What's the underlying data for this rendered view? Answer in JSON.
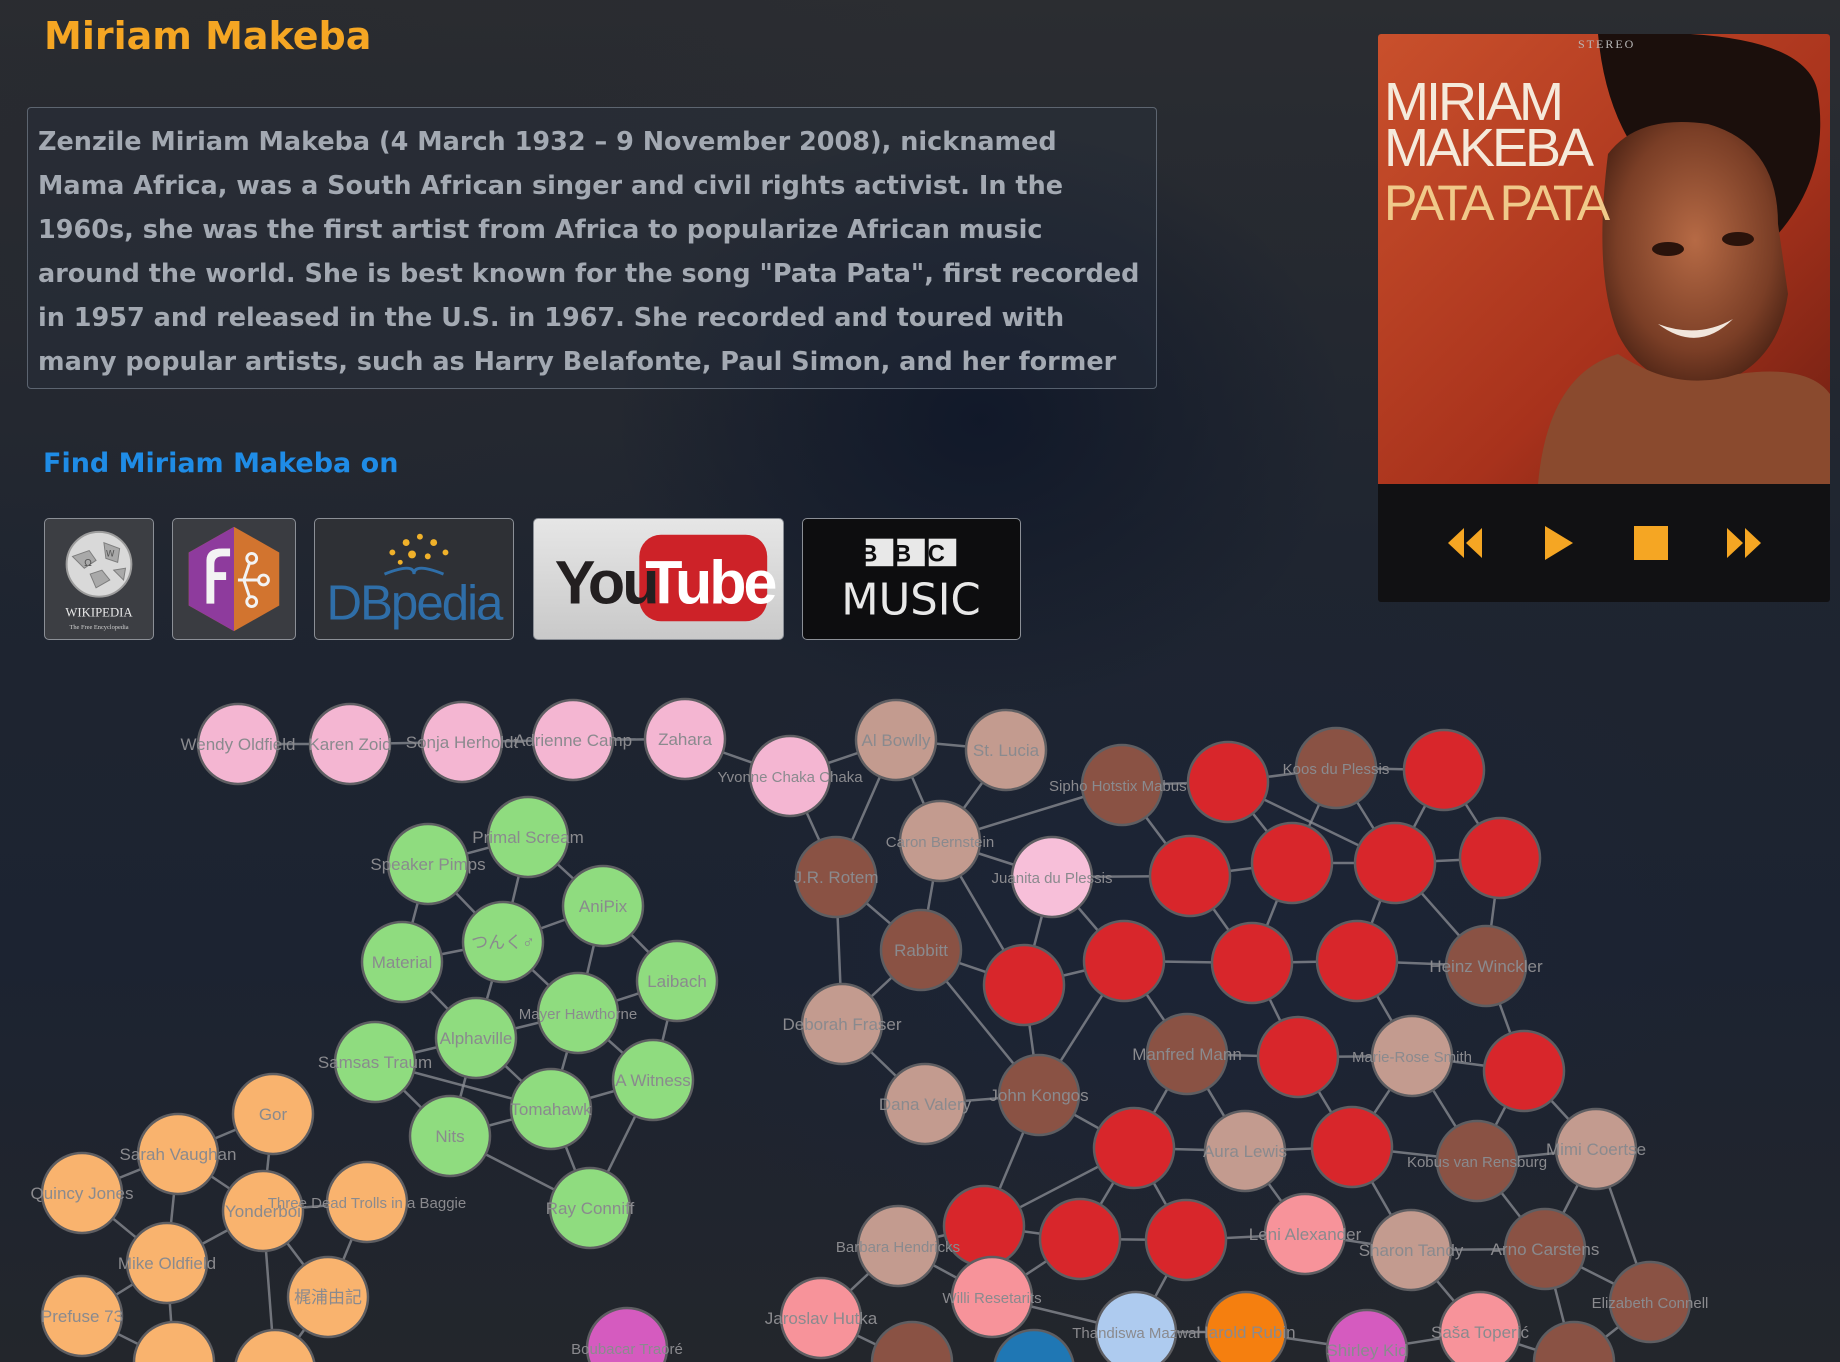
{
  "artist": {
    "name": "Miriam Makeba",
    "bio": "Zenzile Miriam Makeba (4 March 1932 – 9 November 2008), nicknamed Mama Africa, was a South African singer and civil rights activist. In the 1960s, she was the first artist from Africa to popularize African music around the world. She is best known for the song \"Pata Pata\", first recorded in 1957 and released in the U.S. in 1967. She recorded and toured with many popular artists, such as Harry Belafonte, Paul Simon, and her former husband Hugh Masekela. Makeba"
  },
  "find_on": {
    "heading": "Find Miriam Makeba on",
    "links": [
      {
        "name": "Wikipedia",
        "title": "WIKIPEDIA",
        "subtitle": "The Free Encyclopedia"
      },
      {
        "name": "Music Ontology"
      },
      {
        "name": "DBpedia",
        "title": "DBpedia"
      },
      {
        "name": "YouTube",
        "title_a": "You",
        "title_b": "Tube"
      },
      {
        "name": "BBC Music",
        "title_a": "BBC",
        "title_b": "MUSIC"
      }
    ]
  },
  "player": {
    "album_title_line1": "MIRIAM",
    "album_title_line2": "MAKEBA",
    "album_subtitle": "PATA PATA",
    "album_corner": "STEREO",
    "controls": [
      "rewind",
      "play",
      "stop",
      "fast-forward"
    ]
  },
  "colors": {
    "title": "#f5a623",
    "find_heading": "#1f8ce6",
    "control": "#f5a623",
    "pink": "#f4b6d2",
    "green": "#8fdc7f",
    "orange": "#f9b36e",
    "brown": "#8a5244",
    "tan": "#c39b8f",
    "red": "#d8262b",
    "salmon": "#f7939a",
    "light_blue": "#aecbef",
    "dark_orange": "#f57f0f",
    "magenta": "#d55bbf",
    "blue": "#1f77b4",
    "light_pink": "#f7bfd9"
  },
  "graph": {
    "nodes": [
      {
        "id": "wendy",
        "label": "Wendy Oldfield",
        "c": "pink"
      },
      {
        "id": "karen",
        "label": "Karen Zoid",
        "c": "pink"
      },
      {
        "id": "sonja",
        "label": "Sonja Herholdt",
        "c": "pink"
      },
      {
        "id": "adrienne",
        "label": "Adrienne Camp",
        "c": "pink"
      },
      {
        "id": "zahara",
        "label": "Zahara",
        "c": "pink"
      },
      {
        "id": "yvonne",
        "label": "Yvonne Chaka Chaka",
        "c": "pink"
      },
      {
        "id": "albowlly",
        "label": "Al Bowlly",
        "c": "tan"
      },
      {
        "id": "stlucia",
        "label": "St. Lucia",
        "c": "tan"
      },
      {
        "id": "sipho",
        "label": "Sipho Hotstix Mabuse",
        "c": "brown"
      },
      {
        "id": "r1",
        "label": "",
        "c": "red"
      },
      {
        "id": "koos",
        "label": "Koos du Plessis",
        "c": "brown"
      },
      {
        "id": "r2",
        "label": "",
        "c": "red"
      },
      {
        "id": "caron",
        "label": "Caron Bernstein",
        "c": "tan"
      },
      {
        "id": "jrrotem",
        "label": "J.R. Rotem",
        "c": "brown"
      },
      {
        "id": "juanita",
        "label": "Juanita du Plessis",
        "c": "light_pink"
      },
      {
        "id": "r3",
        "label": "",
        "c": "red"
      },
      {
        "id": "r4",
        "label": "",
        "c": "red"
      },
      {
        "id": "r5",
        "label": "",
        "c": "red"
      },
      {
        "id": "r6",
        "label": "",
        "c": "red"
      },
      {
        "id": "rabbitt",
        "label": "Rabbitt",
        "c": "brown"
      },
      {
        "id": "r7",
        "label": "",
        "c": "red"
      },
      {
        "id": "r8",
        "label": "",
        "c": "red"
      },
      {
        "id": "r9",
        "label": "",
        "c": "red"
      },
      {
        "id": "r10",
        "label": "",
        "c": "red"
      },
      {
        "id": "hwinckler",
        "label": "Heinz Winckler",
        "c": "brown"
      },
      {
        "id": "deborah",
        "label": "Deborah Fraser",
        "c": "tan"
      },
      {
        "id": "manfred",
        "label": "Manfred Mann",
        "c": "brown"
      },
      {
        "id": "r11",
        "label": "",
        "c": "red"
      },
      {
        "id": "marierose",
        "label": "Marie-Rose Smith",
        "c": "tan"
      },
      {
        "id": "r12",
        "label": "",
        "c": "red"
      },
      {
        "id": "dana",
        "label": "Dana Valery",
        "c": "tan"
      },
      {
        "id": "johnkongos",
        "label": "John Kongos",
        "c": "brown"
      },
      {
        "id": "r13",
        "label": "",
        "c": "red"
      },
      {
        "id": "auralewis",
        "label": "Aura Lewis",
        "c": "tan"
      },
      {
        "id": "r14",
        "label": "",
        "c": "red"
      },
      {
        "id": "kobus",
        "label": "Kobus van Rensburg",
        "c": "brown"
      },
      {
        "id": "mimi",
        "label": "Mimi Coertse",
        "c": "tan"
      },
      {
        "id": "r15",
        "label": "",
        "c": "red"
      },
      {
        "id": "r16",
        "label": "",
        "c": "red"
      },
      {
        "id": "r17",
        "label": "",
        "c": "red"
      },
      {
        "id": "leni",
        "label": "Leni Alexander",
        "c": "salmon"
      },
      {
        "id": "sharon",
        "label": "Sharon Tandy",
        "c": "tan"
      },
      {
        "id": "arno",
        "label": "Arno Carstens",
        "c": "brown"
      },
      {
        "id": "barbara",
        "label": "Barbara Hendricks",
        "c": "tan"
      },
      {
        "id": "willi",
        "label": "Willi Resetarits",
        "c": "salmon"
      },
      {
        "id": "elizabeth",
        "label": "Elizabeth Connell",
        "c": "brown"
      },
      {
        "id": "jaroslav",
        "label": "Jaroslav Hutka",
        "c": "salmon"
      },
      {
        "id": "thandiswa",
        "label": "Thandiswa Mazwai",
        "c": "light_blue"
      },
      {
        "id": "harold",
        "label": "Harold Rubin",
        "c": "dark_orange"
      },
      {
        "id": "shirley",
        "label": "Shirley Kid",
        "c": "magenta"
      },
      {
        "id": "sasa",
        "label": "Saša Toperić",
        "c": "salmon"
      },
      {
        "id": "b1",
        "label": "",
        "c": "brown"
      },
      {
        "id": "b2",
        "label": "",
        "c": "brown"
      },
      {
        "id": "bl1",
        "label": "",
        "c": "blue"
      },
      {
        "id": "boubacar",
        "label": "Boubacar Traoré",
        "c": "magenta"
      },
      {
        "id": "primal",
        "label": "Primal Scream",
        "c": "green"
      },
      {
        "id": "speaker",
        "label": "Speaker Pimps",
        "c": "green"
      },
      {
        "id": "anipix",
        "label": "AniPix",
        "c": "green"
      },
      {
        "id": "tsunku",
        "label": "つんく♂",
        "c": "green"
      },
      {
        "id": "material",
        "label": "Material",
        "c": "green"
      },
      {
        "id": "laibach",
        "label": "Laibach",
        "c": "green"
      },
      {
        "id": "hawthorne",
        "label": "Mayer Hawthorne",
        "c": "green"
      },
      {
        "id": "alphaville",
        "label": "Alphaville",
        "c": "green"
      },
      {
        "id": "samsas",
        "label": "Samsas Traum",
        "c": "green"
      },
      {
        "id": "witness",
        "label": "A Witness",
        "c": "green"
      },
      {
        "id": "tomahawk",
        "label": "Tomahawk",
        "c": "green"
      },
      {
        "id": "nits",
        "label": "Nits",
        "c": "green"
      },
      {
        "id": "ray",
        "label": "Ray Conniff",
        "c": "green"
      },
      {
        "id": "gor",
        "label": "Gor",
        "c": "orange"
      },
      {
        "id": "sarah",
        "label": "Sarah Vaughan",
        "c": "orange"
      },
      {
        "id": "quincy",
        "label": "Quincy Jones",
        "c": "orange"
      },
      {
        "id": "yonderboi",
        "label": "Yonderboi",
        "c": "orange"
      },
      {
        "id": "threedead",
        "label": "Three Dead Trolls in a Baggie",
        "c": "orange"
      },
      {
        "id": "mike",
        "label": "Mike Oldfield",
        "c": "orange"
      },
      {
        "id": "kajiura",
        "label": "梶浦由記",
        "c": "orange"
      },
      {
        "id": "prefuse",
        "label": "Prefuse 73",
        "c": "orange"
      },
      {
        "id": "o1",
        "label": "",
        "c": "orange"
      },
      {
        "id": "o2",
        "label": "",
        "c": "orange"
      }
    ],
    "edges": [
      [
        "wendy",
        "karen"
      ],
      [
        "karen",
        "sonja"
      ],
      [
        "sonja",
        "adrienne"
      ],
      [
        "adrienne",
        "zahara"
      ],
      [
        "zahara",
        "yvonne"
      ],
      [
        "yvonne",
        "albowlly"
      ],
      [
        "albowlly",
        "stlucia"
      ],
      [
        "albowlly",
        "caron"
      ],
      [
        "albowlly",
        "jrrotem"
      ],
      [
        "yvonne",
        "jrrotem"
      ],
      [
        "stlucia",
        "caron"
      ],
      [
        "caron",
        "juanita"
      ],
      [
        "caron",
        "sipho"
      ],
      [
        "caron",
        "rabbitt"
      ],
      [
        "jrrotem",
        "rabbitt"
      ],
      [
        "jrrotem",
        "deborah"
      ],
      [
        "caron",
        "r7"
      ],
      [
        "sipho",
        "r1"
      ],
      [
        "r1",
        "koos"
      ],
      [
        "koos",
        "r2"
      ],
      [
        "sipho",
        "r3"
      ],
      [
        "r1",
        "r4"
      ],
      [
        "r1",
        "r5"
      ],
      [
        "koos",
        "r5"
      ],
      [
        "koos",
        "r4"
      ],
      [
        "r2",
        "r6"
      ],
      [
        "r2",
        "r5"
      ],
      [
        "juanita",
        "r3"
      ],
      [
        "juanita",
        "r8"
      ],
      [
        "juanita",
        "r7"
      ],
      [
        "r3",
        "r4"
      ],
      [
        "r4",
        "r5"
      ],
      [
        "r5",
        "r6"
      ],
      [
        "r3",
        "r9"
      ],
      [
        "r4",
        "r9"
      ],
      [
        "r5",
        "r10"
      ],
      [
        "r6",
        "hwinckler"
      ],
      [
        "r5",
        "hwinckler"
      ],
      [
        "rabbitt",
        "r7"
      ],
      [
        "rabbitt",
        "johnkongos"
      ],
      [
        "r7",
        "r8"
      ],
      [
        "r8",
        "r9"
      ],
      [
        "r9",
        "r10"
      ],
      [
        "r10",
        "hwinckler"
      ],
      [
        "r8",
        "manfred"
      ],
      [
        "r9",
        "r11"
      ],
      [
        "r10",
        "marierose"
      ],
      [
        "hwinckler",
        "r12"
      ],
      [
        "deborah",
        "dana"
      ],
      [
        "deborah",
        "rabbitt"
      ],
      [
        "r7",
        "johnkongos"
      ],
      [
        "r8",
        "johnkongos"
      ],
      [
        "manfred",
        "r11"
      ],
      [
        "r11",
        "marierose"
      ],
      [
        "marierose",
        "r12"
      ],
      [
        "dana",
        "johnkongos"
      ],
      [
        "johnkongos",
        "r13"
      ],
      [
        "johnkongos",
        "r15"
      ],
      [
        "manfred",
        "r13"
      ],
      [
        "manfred",
        "auralewis"
      ],
      [
        "r11",
        "r14"
      ],
      [
        "marierose",
        "r14"
      ],
      [
        "marierose",
        "kobus"
      ],
      [
        "r12",
        "kobus"
      ],
      [
        "r12",
        "mimi"
      ],
      [
        "r13",
        "auralewis"
      ],
      [
        "auralewis",
        "r14"
      ],
      [
        "r14",
        "kobus"
      ],
      [
        "kobus",
        "mimi"
      ],
      [
        "r13",
        "r15"
      ],
      [
        "r13",
        "r16"
      ],
      [
        "r13",
        "r17"
      ],
      [
        "auralewis",
        "leni"
      ],
      [
        "r14",
        "sharon"
      ],
      [
        "kobus",
        "arno"
      ],
      [
        "mimi",
        "arno"
      ],
      [
        "mimi",
        "elizabeth"
      ],
      [
        "r15",
        "r16"
      ],
      [
        "r16",
        "r17"
      ],
      [
        "r17",
        "leni"
      ],
      [
        "leni",
        "sharon"
      ],
      [
        "sharon",
        "arno"
      ],
      [
        "arno",
        "elizabeth"
      ],
      [
        "r15",
        "barbara"
      ],
      [
        "r15",
        "willi"
      ],
      [
        "r16",
        "willi"
      ],
      [
        "r17",
        "thandiswa"
      ],
      [
        "barbara",
        "willi"
      ],
      [
        "barbara",
        "jaroslav"
      ],
      [
        "willi",
        "thandiswa"
      ],
      [
        "thandiswa",
        "harold"
      ],
      [
        "harold",
        "shirley"
      ],
      [
        "sharon",
        "sasa"
      ],
      [
        "shirley",
        "sasa"
      ],
      [
        "jaroslav",
        "b1"
      ],
      [
        "b1",
        "bl1"
      ],
      [
        "sasa",
        "b2"
      ],
      [
        "arno",
        "b2"
      ],
      [
        "elizabeth",
        "b2"
      ],
      [
        "primal",
        "speaker"
      ],
      [
        "primal",
        "anipix"
      ],
      [
        "primal",
        "tsunku"
      ],
      [
        "speaker",
        "tsunku"
      ],
      [
        "speaker",
        "material"
      ],
      [
        "anipix",
        "tsunku"
      ],
      [
        "anipix",
        "laibach"
      ],
      [
        "anipix",
        "hawthorne"
      ],
      [
        "tsunku",
        "material"
      ],
      [
        "tsunku",
        "alphaville"
      ],
      [
        "tsunku",
        "hawthorne"
      ],
      [
        "material",
        "alphaville"
      ],
      [
        "laibach",
        "hawthorne"
      ],
      [
        "laibach",
        "witness"
      ],
      [
        "hawthorne",
        "alphaville"
      ],
      [
        "hawthorne",
        "tomahawk"
      ],
      [
        "hawthorne",
        "witness"
      ],
      [
        "alphaville",
        "samsas"
      ],
      [
        "alphaville",
        "nits"
      ],
      [
        "alphaville",
        "tomahawk"
      ],
      [
        "samsas",
        "nits"
      ],
      [
        "nits",
        "tomahawk"
      ],
      [
        "tomahawk",
        "witness"
      ],
      [
        "tomahawk",
        "ray"
      ],
      [
        "witness",
        "ray"
      ],
      [
        "nits",
        "ray"
      ],
      [
        "samsas",
        "tomahawk"
      ],
      [
        "gor",
        "sarah"
      ],
      [
        "gor",
        "yonderboi"
      ],
      [
        "sarah",
        "quincy"
      ],
      [
        "sarah",
        "yonderboi"
      ],
      [
        "sarah",
        "mike"
      ],
      [
        "quincy",
        "mike"
      ],
      [
        "yonderboi",
        "threedead"
      ],
      [
        "yonderboi",
        "kajiura"
      ],
      [
        "yonderboi",
        "mike"
      ],
      [
        "threedead",
        "kajiura"
      ],
      [
        "mike",
        "prefuse"
      ],
      [
        "mike",
        "o1"
      ],
      [
        "prefuse",
        "o1"
      ],
      [
        "kajiura",
        "o2"
      ],
      [
        "yonderboi",
        "o2"
      ]
    ]
  }
}
